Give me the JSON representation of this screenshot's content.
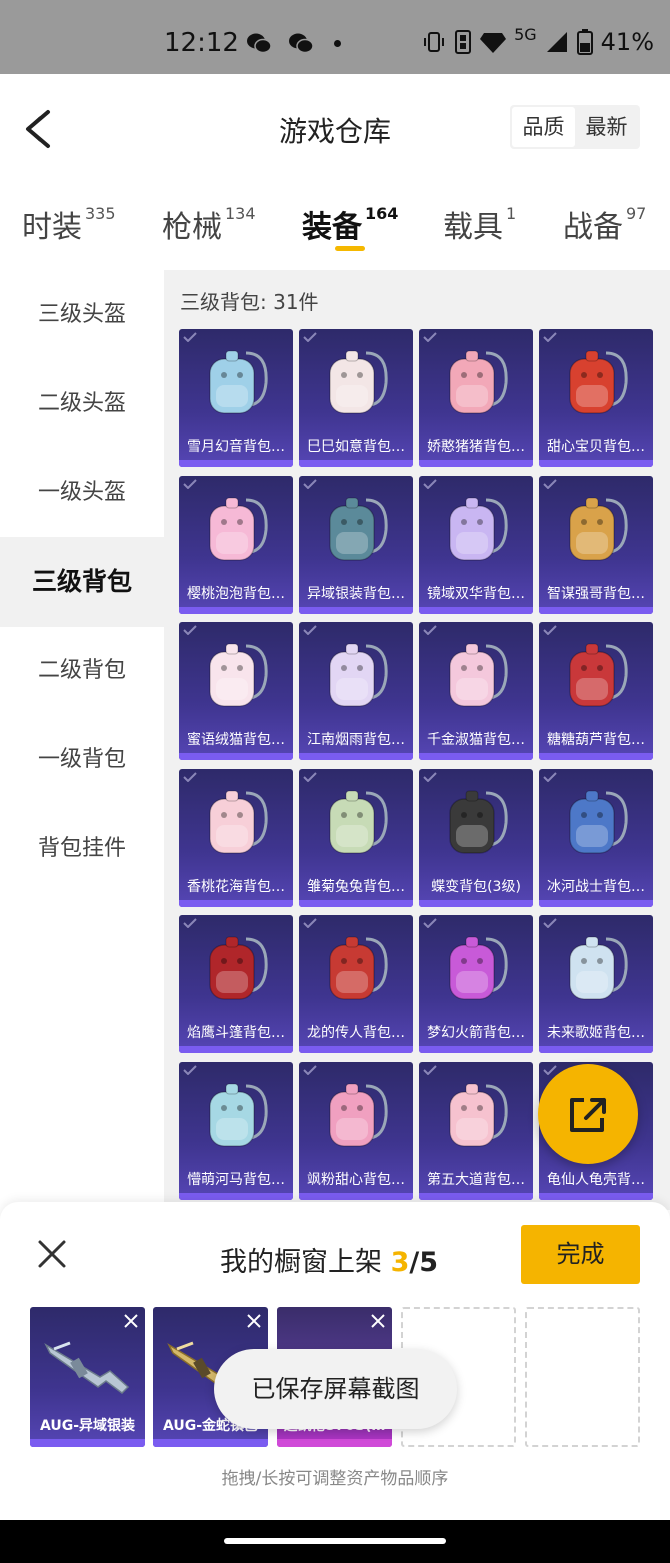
{
  "status_bar": {
    "time": "12:12",
    "network": "5G",
    "battery": "41%",
    "icons": [
      "wechat-icon",
      "wechat-icon",
      "dot",
      "vibrate-icon",
      "nfc-icon",
      "diamond-icon",
      "signal-icon",
      "battery-icon"
    ]
  },
  "header": {
    "title": "游戏仓库",
    "sort_options": [
      {
        "label": "品质",
        "active": true
      },
      {
        "label": "最新",
        "active": false
      }
    ]
  },
  "tabs": [
    {
      "label": "时装",
      "count": "335"
    },
    {
      "label": "枪械",
      "count": "134"
    },
    {
      "label": "装备",
      "count": "164",
      "active": true
    },
    {
      "label": "载具",
      "count": "1"
    },
    {
      "label": "战备",
      "count": "97"
    }
  ],
  "sidebar": {
    "items": [
      {
        "label": "三级头盔"
      },
      {
        "label": "二级头盔"
      },
      {
        "label": "一级头盔"
      },
      {
        "label": "三级背包",
        "active": true
      },
      {
        "label": "二级背包"
      },
      {
        "label": "一级背包"
      },
      {
        "label": "背包挂件"
      }
    ]
  },
  "content": {
    "section_title": "三级背包: 31件",
    "items": [
      {
        "name": "雪月幻音背包…",
        "art": "#9fd0e8"
      },
      {
        "name": "巳巳如意背包…",
        "art": "#f3e6e6"
      },
      {
        "name": "娇憨猪猪背包…",
        "art": "#f2a8b8"
      },
      {
        "name": "甜心宝贝背包…",
        "art": "#d8412f"
      },
      {
        "name": "樱桃泡泡背包…",
        "art": "#f6b9d6"
      },
      {
        "name": "异域银装背包…",
        "art": "#5b8a9a"
      },
      {
        "name": "镜域双华背包…",
        "art": "#c9b6f2"
      },
      {
        "name": "智谋强哥背包…",
        "art": "#d9a24a"
      },
      {
        "name": "蜜语绒猫背包…",
        "art": "#f8e4ec"
      },
      {
        "name": "江南烟雨背包…",
        "art": "#e2d6f4"
      },
      {
        "name": "千金淑猫背包…",
        "art": "#f4c8dc"
      },
      {
        "name": "糖糖葫芦背包…",
        "art": "#c9383a"
      },
      {
        "name": "香桃花海背包…",
        "art": "#f7cfd8"
      },
      {
        "name": "雏菊兔兔背包…",
        "art": "#c7dbb6"
      },
      {
        "name": "蝶变背包(3级)",
        "art": "#3a3a3a"
      },
      {
        "name": "冰河战士背包…",
        "art": "#4d78c8"
      },
      {
        "name": "焰鹰斗篷背包…",
        "art": "#b0262a"
      },
      {
        "name": "龙的传人背包…",
        "art": "#c73a33"
      },
      {
        "name": "梦幻火箭背包…",
        "art": "#c85ad8"
      },
      {
        "name": "未来歌姬背包…",
        "art": "#cfe2f0"
      },
      {
        "name": "懵萌河马背包…",
        "art": "#a6d8e4"
      },
      {
        "name": "飒粉甜心背包…",
        "art": "#f0a0c0"
      },
      {
        "name": "第五大道背包…",
        "art": "#f6c2cf"
      },
      {
        "name": "龟仙人龟壳背…",
        "art": "#4fa04a"
      }
    ]
  },
  "fab": {
    "icon": "share-external-icon"
  },
  "bottom_sheet": {
    "title": "我的橱窗上架 ",
    "current": "3",
    "separator": "/",
    "total": "5",
    "done_label": "完成",
    "slots": [
      {
        "name": "AUG-异域银装",
        "filled": true
      },
      {
        "name": "AUG-金蛇镇邑",
        "filled": true
      },
      {
        "name": "迈凯伦570S(…",
        "filled": true
      },
      {
        "name": "",
        "filled": false
      },
      {
        "name": "",
        "filled": false
      }
    ],
    "hint": "拖拽/长按可调整资产物品顺序"
  },
  "toast": {
    "text": "已保存屏幕截图"
  },
  "colors": {
    "accent": "#f5b400",
    "card_top": "#2e2a6a",
    "card_bottom": "#5646b5",
    "card_strip": "#7a5cf0"
  }
}
